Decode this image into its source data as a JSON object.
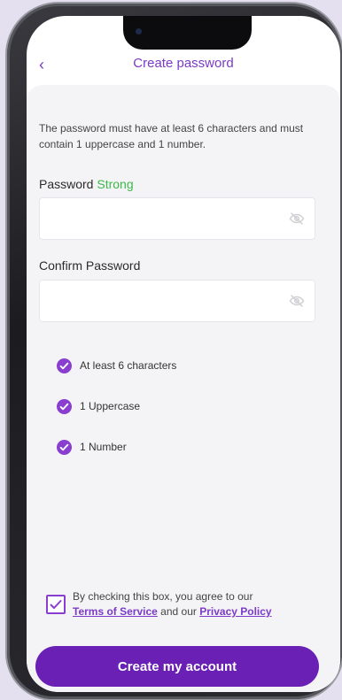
{
  "header": {
    "title": "Create password",
    "back_icon": "chevron-left-icon"
  },
  "description": "The password must have at least 6 characters  and must contain 1 uppercase and 1 number.",
  "password": {
    "label": "Password",
    "strength": "Strong",
    "value": "",
    "toggle_icon": "eye-off-icon"
  },
  "confirm_password": {
    "label": "Confirm Password",
    "value": "",
    "toggle_icon": "eye-off-icon"
  },
  "requirements": [
    {
      "label": "At least 6 characters",
      "met": true
    },
    {
      "label": "1 Uppercase",
      "met": true
    },
    {
      "label": "1 Number",
      "met": true
    }
  ],
  "agreement": {
    "checked": true,
    "prefix": "By checking this box, you agree to our",
    "terms_link": "Terms of Service",
    "middle": "and our",
    "privacy_link": "Privacy Policy"
  },
  "submit": {
    "label": "Create my account"
  },
  "colors": {
    "accent": "#7b3ac8",
    "button": "#6a1fb5",
    "success": "#3eb84a",
    "content_bg": "#f4f4f6"
  }
}
